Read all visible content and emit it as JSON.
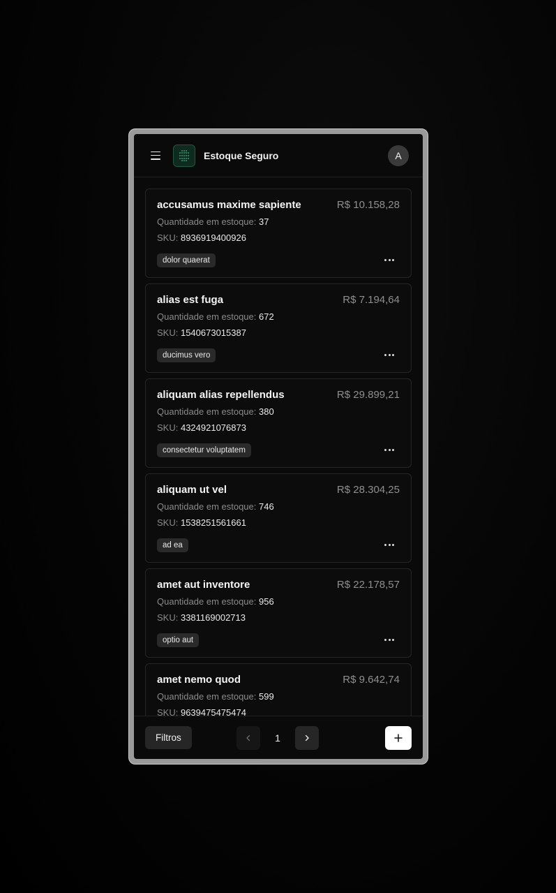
{
  "app": {
    "title": "Estoque Seguro",
    "avatar_initial": "A"
  },
  "icons": {
    "menu": "menu-icon",
    "logo": "grid-logo-icon",
    "more": "more-dots-icon",
    "prev": "chevron-left-icon",
    "next": "chevron-right-icon",
    "add": "plus-icon"
  },
  "labels": {
    "qty": "Quantidade em estoque: ",
    "sku": "SKU: "
  },
  "products": [
    {
      "name": "accusamus maxime sapiente",
      "price": "R$ 10.158,28",
      "qty": "37",
      "sku": "8936919400926",
      "tag": "dolor quaerat"
    },
    {
      "name": "alias est fuga",
      "price": "R$ 7.194,64",
      "qty": "672",
      "sku": "1540673015387",
      "tag": "ducimus vero"
    },
    {
      "name": "aliquam alias repellendus",
      "price": "R$ 29.899,21",
      "qty": "380",
      "sku": "4324921076873",
      "tag": "consectetur voluptatem"
    },
    {
      "name": "aliquam ut vel",
      "price": "R$ 28.304,25",
      "qty": "746",
      "sku": "1538251561661",
      "tag": "ad ea"
    },
    {
      "name": "amet aut inventore",
      "price": "R$ 22.178,57",
      "qty": "956",
      "sku": "3381169002713",
      "tag": "optio aut"
    },
    {
      "name": "amet nemo quod",
      "price": "R$ 9.642,74",
      "qty": "599",
      "sku": "9639475475474",
      "tag": ""
    }
  ],
  "footer": {
    "filters_label": "Filtros",
    "page": "1"
  }
}
